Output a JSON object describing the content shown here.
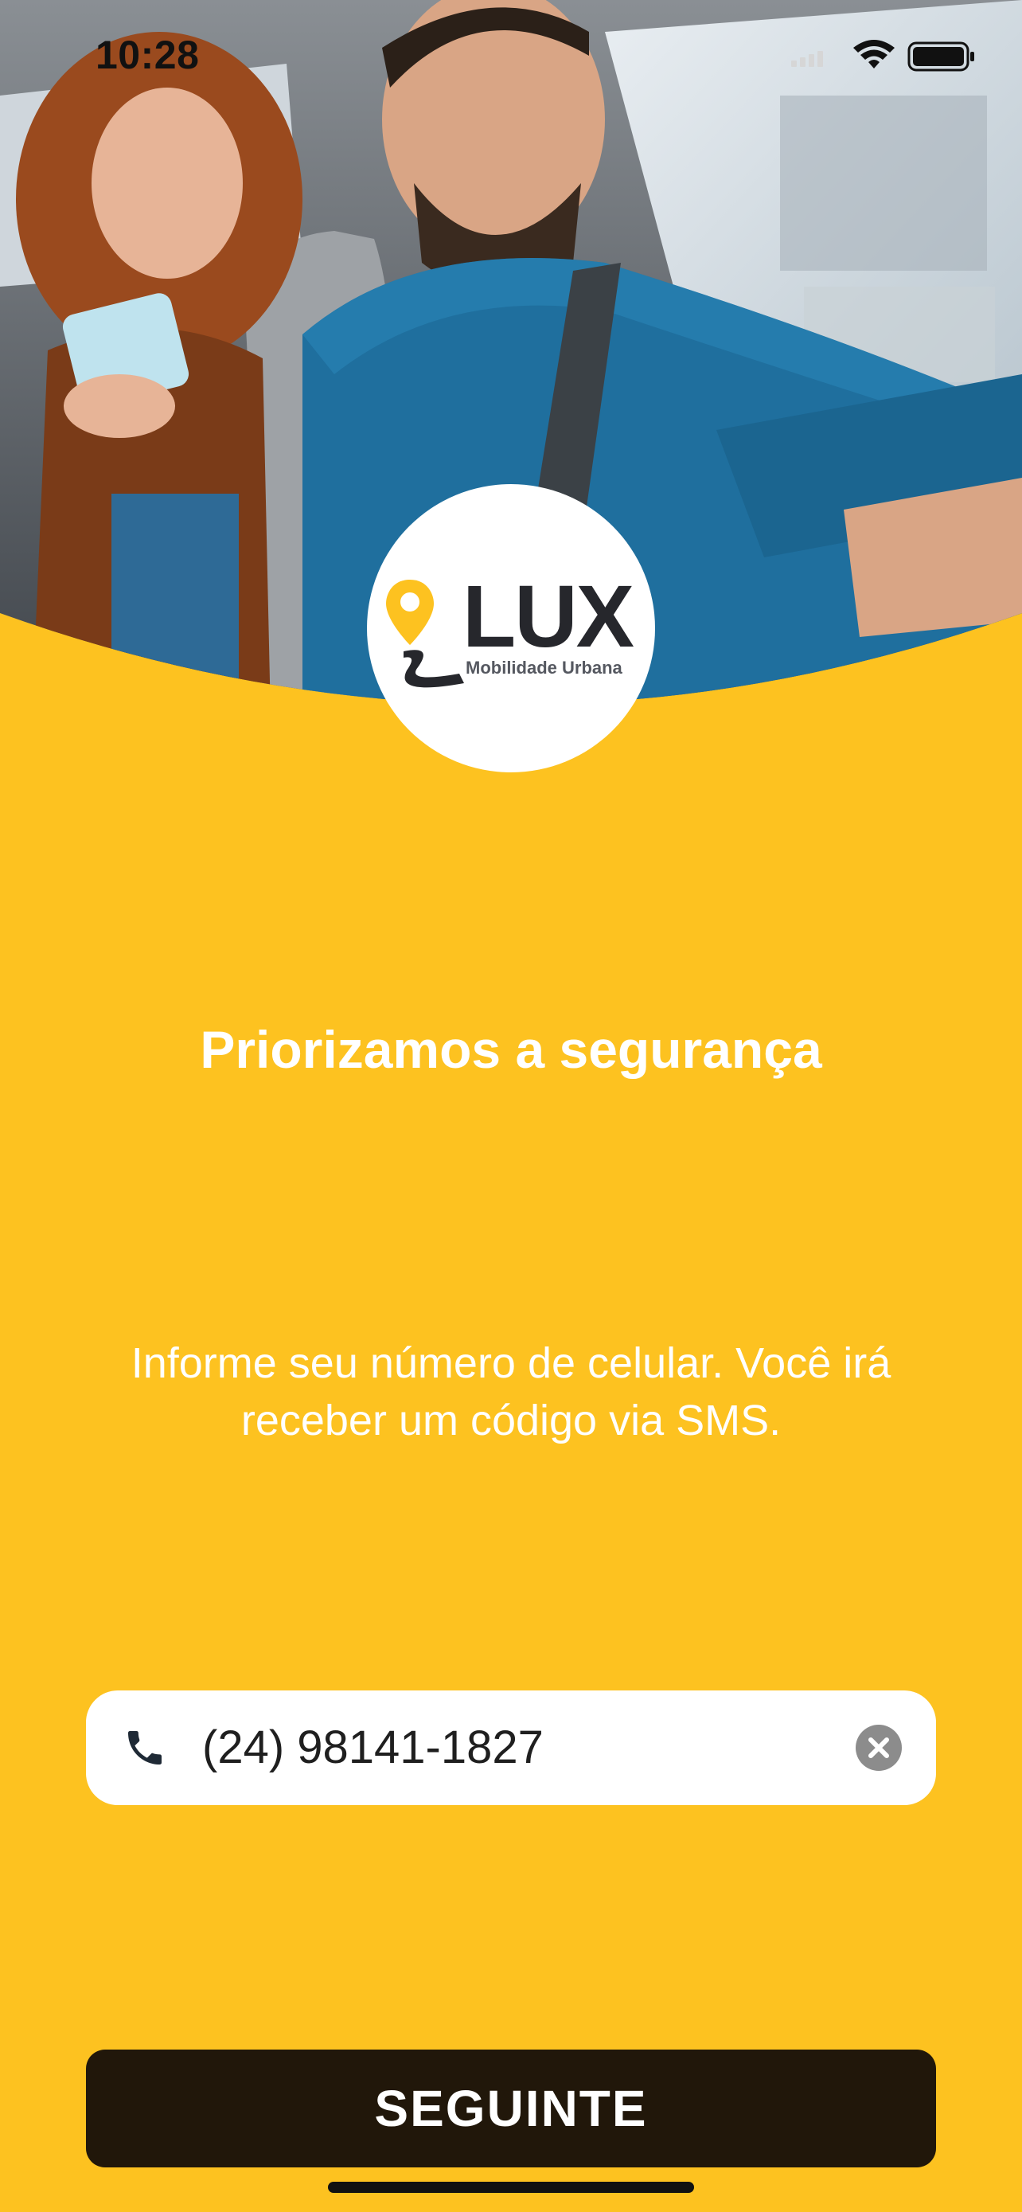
{
  "status_bar": {
    "time": "10:28"
  },
  "brand": {
    "name": "LUX",
    "tagline": "Mobilidade Urbana",
    "accent_color": "#FDC220",
    "dark_color": "#26272C"
  },
  "hero": {
    "image_description_icon": "photo-driver-passenger"
  },
  "content": {
    "title": "Priorizamos a segurança",
    "subtitle": "Informe seu número de celular. Você irá receber um código via SMS."
  },
  "phone_input": {
    "value": "(24) 98141-1827",
    "leading_icon": "phone-icon",
    "trailing_icon": "clear-icon"
  },
  "actions": {
    "next_label": "SEGUINTE"
  }
}
